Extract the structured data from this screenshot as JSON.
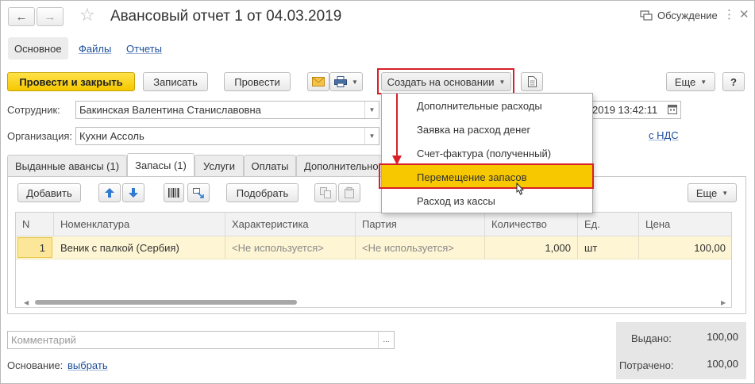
{
  "header": {
    "title": "Авансовый отчет 1 от 04.03.2019",
    "discussion": "Обсуждение"
  },
  "sections": [
    "Основное",
    "Файлы",
    "Отчеты"
  ],
  "toolbar": {
    "post_close": "Провести и закрыть",
    "save": "Записать",
    "post": "Провести",
    "create_based": "Создать на основании",
    "more": "Еще",
    "help": "?"
  },
  "fields": {
    "employee_label": "Сотрудник:",
    "employee_value": "Бакинская Валентина Станиславовна",
    "org_label": "Организация:",
    "org_value": "Кухни Ассоль",
    "datetime_visible": "2019 13:42:11",
    "vat_link": "с НДС"
  },
  "tabs": [
    "Выданные авансы (1)",
    "Запасы (1)",
    "Услуги",
    "Оплаты",
    "Дополнительно"
  ],
  "table_toolbar": {
    "add": "Добавить",
    "pick": "Подобрать",
    "more": "Еще"
  },
  "table": {
    "columns": [
      "N",
      "Номенклатура",
      "Характеристика",
      "Партия",
      "Количество",
      "Ед.",
      "Цена"
    ],
    "rows": [
      {
        "n": "1",
        "item": "Веник с палкой (Сербия)",
        "characteristic": "<Не используется>",
        "batch": "<Не используется>",
        "qty": "1,000",
        "unit": "шт",
        "price": "100,00"
      }
    ]
  },
  "dropdown_menu": {
    "items": [
      "Дополнительные расходы",
      "Заявка на расход денег",
      "Счет-фактура (полученный)",
      "Перемещение запасов",
      "Расход из кассы"
    ],
    "highlighted_index": 3
  },
  "footer": {
    "comment_placeholder": "Комментарий",
    "basis_label": "Основание:",
    "basis_link": "выбрать",
    "issued_label": "Выдано:",
    "issued_value": "100,00",
    "spent_label": "Потрачено:",
    "spent_value": "100,00"
  },
  "colors": {
    "primary_button": "#f5c800",
    "highlight": "#f7c800",
    "annotation_red": "#d8202a",
    "link": "#1c4e9c",
    "selected_row": "#fdf5d3"
  }
}
